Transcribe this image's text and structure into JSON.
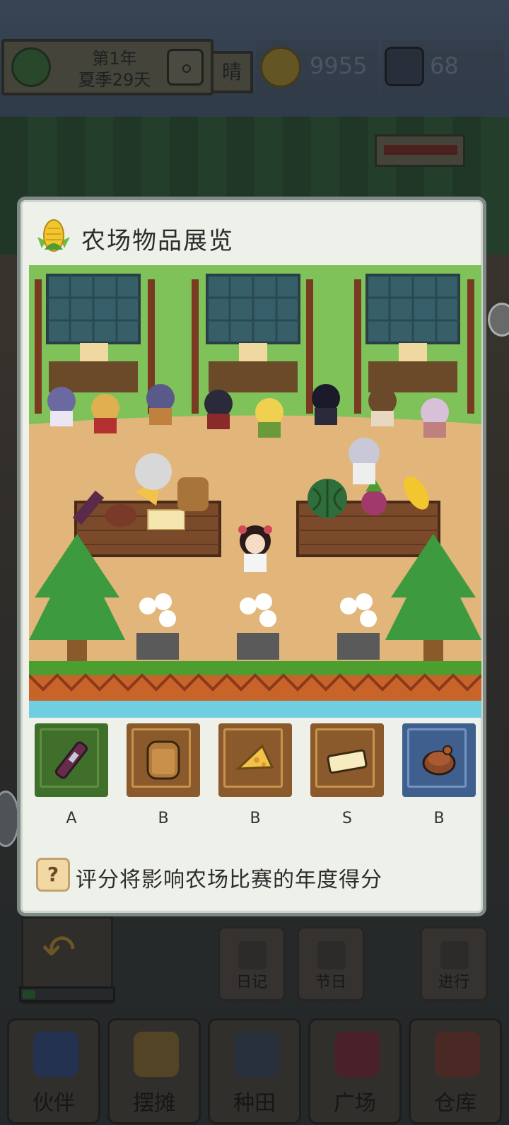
{
  "hud": {
    "year": "第1年",
    "season_day": "夏季29天",
    "weather": "晴",
    "coins": "9955",
    "gems": "68"
  },
  "modal": {
    "title": "农场物品展览",
    "items": [
      {
        "icon": "wine-bottle-icon",
        "grade": "A",
        "frame": "#5e8f3e",
        "bg": "#3f6f2a"
      },
      {
        "icon": "bread-icon",
        "grade": "B",
        "frame": "#c9924a",
        "bg": "#8a5a2c"
      },
      {
        "icon": "cheese-icon",
        "grade": "B",
        "frame": "#c9924a",
        "bg": "#8a5a2c"
      },
      {
        "icon": "butter-icon",
        "grade": "S",
        "frame": "#c9924a",
        "bg": "#8a5a2c"
      },
      {
        "icon": "pie-icon",
        "grade": "B",
        "frame": "#7393c0",
        "bg": "#3f5f8f"
      }
    ],
    "hint": "评分将影响农场比赛的年度得分"
  },
  "small_buttons": [
    {
      "label": "日记",
      "icon": "diary-icon"
    },
    {
      "label": "节日",
      "icon": "festival-icon"
    },
    {
      "label": "进行",
      "icon": "play-icon"
    }
  ],
  "nav": [
    {
      "label": "伙伴",
      "icon": "partners-icon"
    },
    {
      "label": "摆摊",
      "icon": "stall-icon"
    },
    {
      "label": "种田",
      "icon": "farming-icon"
    },
    {
      "label": "广场",
      "icon": "plaza-icon"
    },
    {
      "label": "仓库",
      "icon": "warehouse-icon"
    }
  ],
  "colors": {
    "modal_bg": "#eef0ea",
    "grade_s": "#333333"
  }
}
